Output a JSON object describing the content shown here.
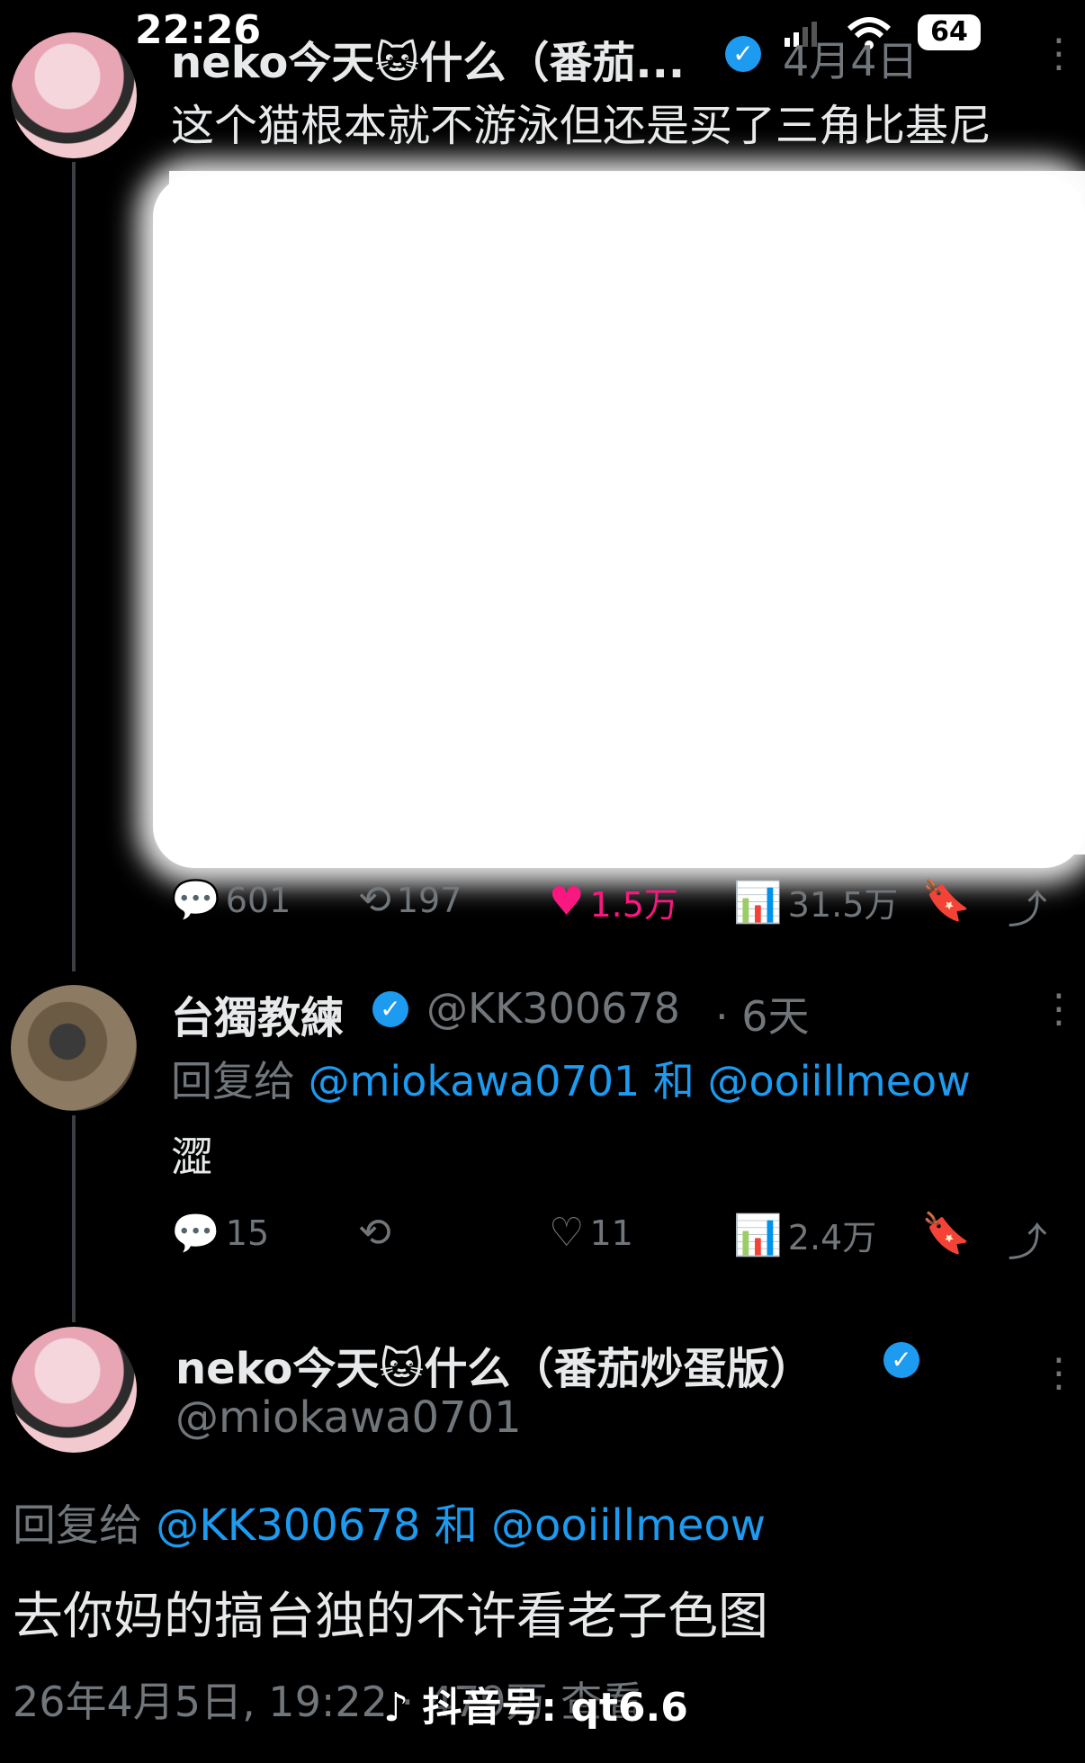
{
  "status_bar": {
    "time": "22:26",
    "battery": "64"
  },
  "tweet1": {
    "author": "neko今天🐱什么（番茄...",
    "date": "4月4日",
    "text": "这个猫根本就不游泳但还是买了三角比基尼",
    "stats": {
      "replies": "601",
      "retweets": "197",
      "likes": "1.5万",
      "views": "31.5万"
    }
  },
  "tweet2": {
    "author": "台獨教練",
    "handle": "@KK300678",
    "time": "· 6天",
    "reply_prefix": "回复给",
    "mention1": "@miokawa0701",
    "and": "和",
    "mention2": "@ooiillmeow",
    "text": "澀",
    "stats": {
      "replies": "15",
      "retweets": "",
      "likes": "11",
      "views": "2.4万"
    }
  },
  "tweet3": {
    "author": "neko今天🐱什么（番茄炒蛋版）",
    "handle": "@miokawa0701",
    "reply_prefix": "回复给",
    "mention1": "@KK300678",
    "and": "和",
    "mention2": "@ooiillmeow",
    "text": "去你妈的搞台独的不许看老子色图",
    "timestamp": "26年4月5日, 19:22 · 479万 查看"
  },
  "watermark": {
    "label": "抖音号: qt6.6"
  },
  "colors": {
    "background": "#000000",
    "accent": "#1d9bf0",
    "like": "#f91880",
    "muted": "#71767b"
  },
  "icons": [
    "reply-icon",
    "retweet-icon",
    "heart-icon",
    "views-icon",
    "bookmark-icon",
    "share-icon",
    "verified-icon",
    "more-icon",
    "tiktok-icon"
  ]
}
